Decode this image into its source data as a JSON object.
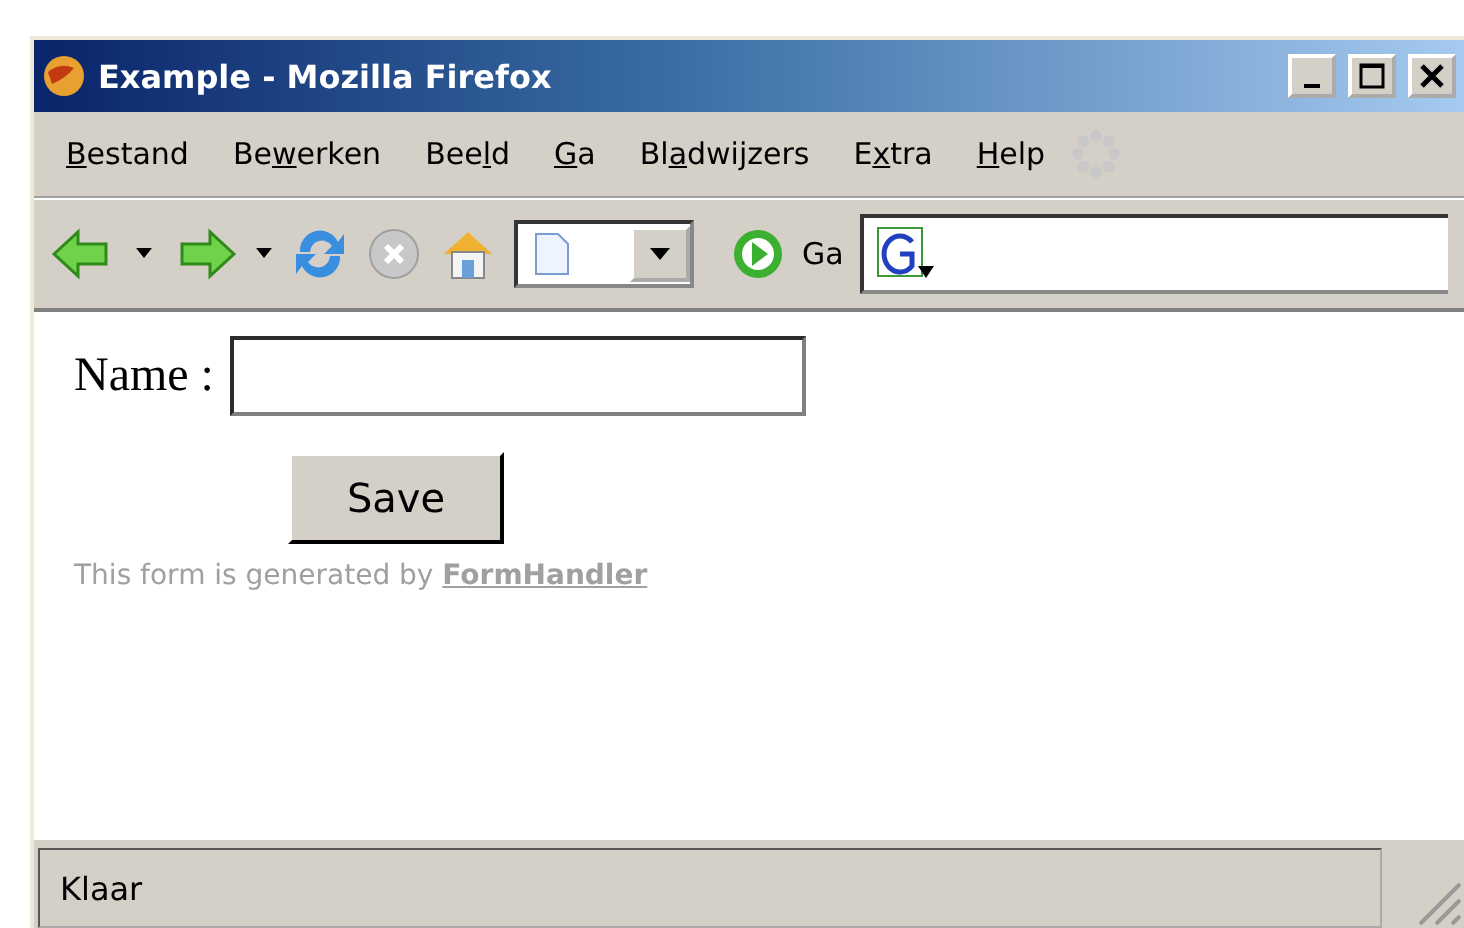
{
  "window": {
    "title": "Example - Mozilla Firefox"
  },
  "menu": [
    {
      "key": "B",
      "post": "estand"
    },
    {
      "pre": "Be",
      "key": "w",
      "post": "erken"
    },
    {
      "pre": "Bee",
      "key": "l",
      "post": "d"
    },
    {
      "key": "G",
      "post": "a"
    },
    {
      "pre": "Bl",
      "key": "a",
      "post": "dwijzers"
    },
    {
      "pre": "E",
      "key": "x",
      "post": "tra"
    },
    {
      "key": "H",
      "post": "elp"
    }
  ],
  "toolbar": {
    "go_label": "Ga"
  },
  "form": {
    "label": "Name :",
    "button": "Save",
    "footer": "This form is generated by ",
    "footer_link": "FormHandler"
  },
  "status_bar": {
    "text": "Klaar"
  }
}
